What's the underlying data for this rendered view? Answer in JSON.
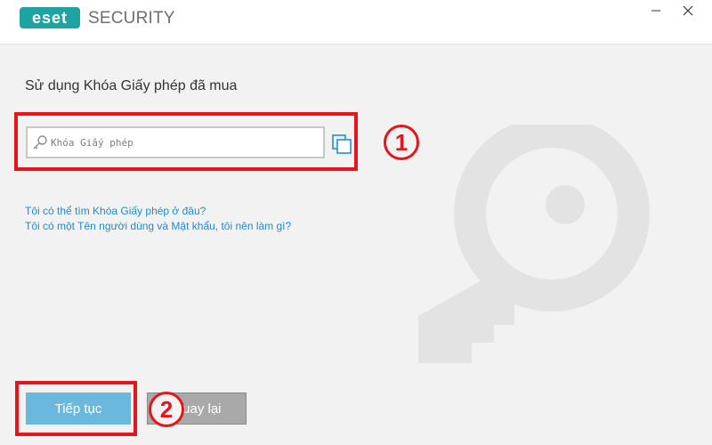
{
  "window": {
    "brand": "SECURITY",
    "logo_text": "eset",
    "minimize_glyph": "—",
    "close_glyph": "✕"
  },
  "main": {
    "heading": "Sử dụng Khóa Giấy phép đã mua",
    "license_field": {
      "placeholder": "Khóa Giấy phép",
      "value": ""
    },
    "links": [
      "Tôi có thể tìm Khóa Giấy phép ở đâu?",
      "Tôi có một Tên người dùng và Mật khẩu, tôi nên làm gì?"
    ]
  },
  "buttons": {
    "next": "Tiếp tục",
    "back": "Quay lại"
  },
  "annotations": {
    "step1": "1",
    "step2": "2"
  },
  "icons": {
    "field": "key-icon",
    "paste": "paste-icon",
    "watermark": "key-watermark-icon"
  },
  "colors": {
    "accent_blue": "#1a8ccf",
    "next_button": "#6bb8df",
    "back_button": "#a9a9a9",
    "highlight_red": "#e8141b",
    "eset_teal": "#1fa2a2"
  }
}
